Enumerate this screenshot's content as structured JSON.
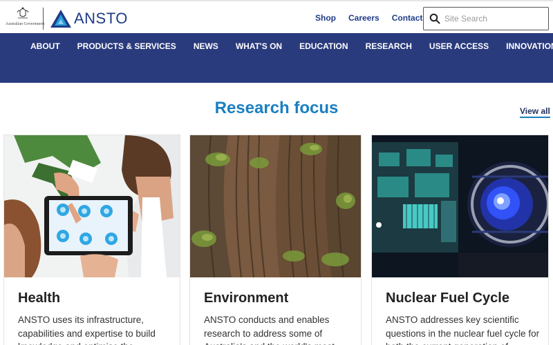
{
  "header": {
    "gov_text": "Australian Government",
    "brand_name": "ANSTO",
    "top_links": [
      "Shop",
      "Careers",
      "Contact"
    ],
    "search": {
      "placeholder": "Site Search",
      "value": ""
    }
  },
  "nav": {
    "items": [
      "ABOUT",
      "PRODUCTS & SERVICES",
      "NEWS",
      "WHAT'S ON",
      "EDUCATION",
      "RESEARCH",
      "USER ACCESS",
      "INNOVATION"
    ]
  },
  "main": {
    "title": "Research focus",
    "view_all": "View all",
    "cards": [
      {
        "title": "Health",
        "text": "ANSTO uses its infrastructure, capabilities and expertise to build knowledge and optimise the"
      },
      {
        "title": "Environment",
        "text": "ANSTO conducts and enables research to address some of Australia's and the world's most"
      },
      {
        "title": "Nuclear Fuel Cycle",
        "text": "ANSTO addresses key scientific questions in the nuclear fuel cycle for both the current generation of"
      }
    ]
  },
  "colors": {
    "brand_blue": "#1f3c88",
    "nav_bg": "#2a3b7d",
    "accent": "#1a7fc1"
  },
  "icons": [
    "australian-government-crest",
    "ansto-logo-mark",
    "search-icon"
  ]
}
